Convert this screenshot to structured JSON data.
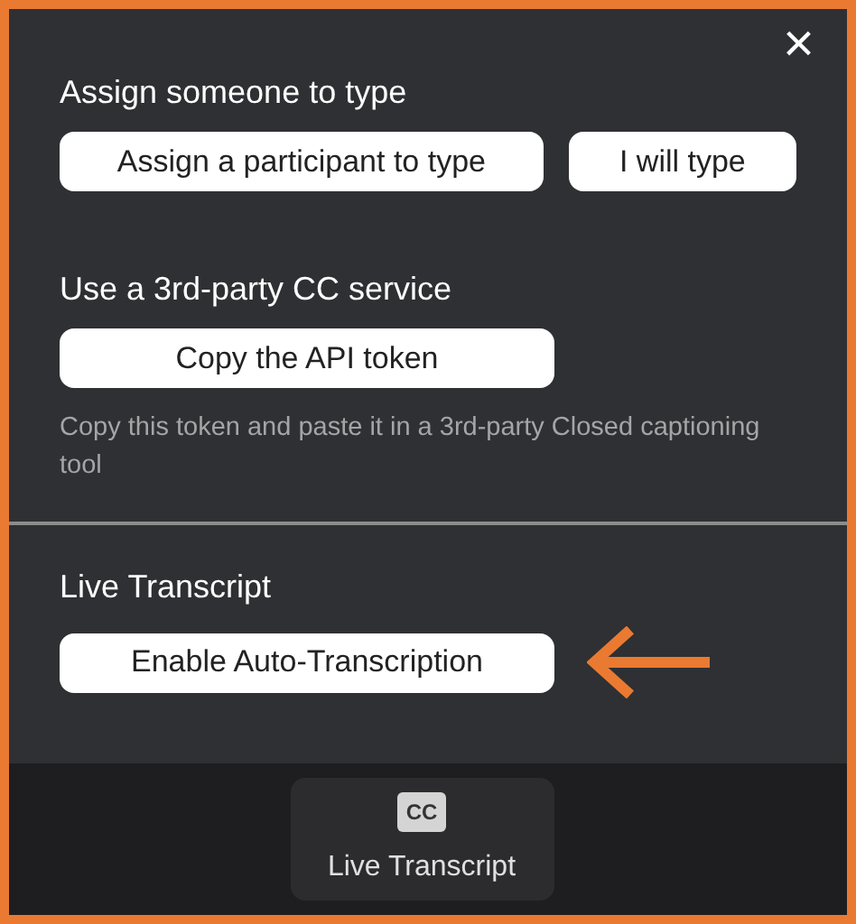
{
  "close_button": {
    "glyph": "×"
  },
  "sections": [
    {
      "heading": "Assign someone to type",
      "buttons": [
        "Assign a participant to type",
        "I will type"
      ]
    },
    {
      "heading": "Use a 3rd-party CC service",
      "buttons": [
        "Copy the API token"
      ],
      "note": "Copy this token and paste it in a 3rd-party Closed captioning tool"
    },
    {
      "heading": "Live Transcript",
      "buttons": [
        "Enable Auto-Transcription"
      ],
      "highlighted": true
    }
  ],
  "toolbar": {
    "badge": "CC",
    "label": "Live Transcript"
  }
}
